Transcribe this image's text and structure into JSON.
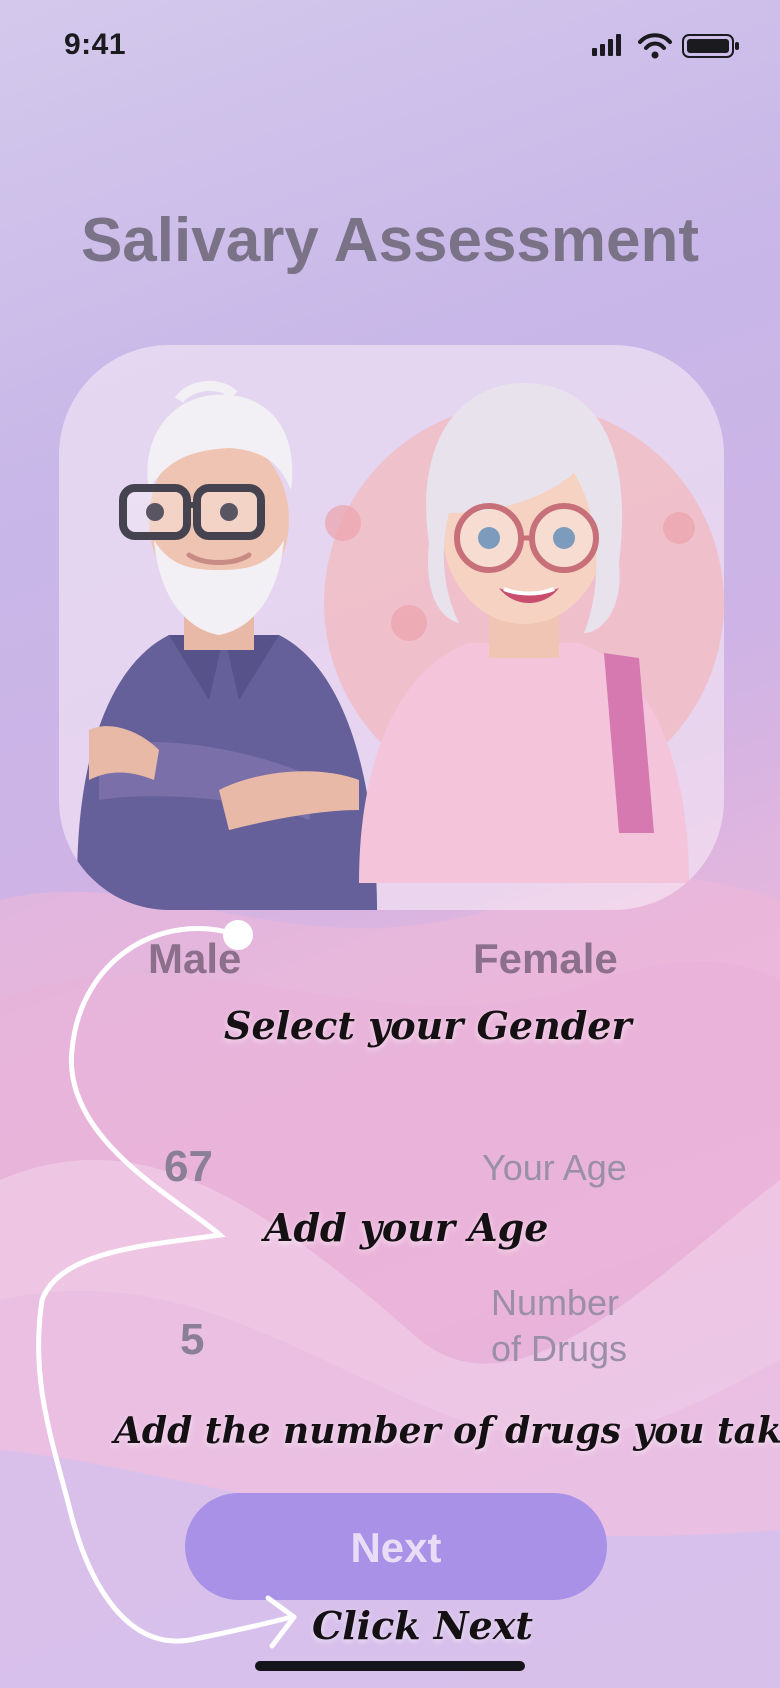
{
  "status_bar": {
    "time": "9:41",
    "icons": [
      "cellular-signal-icon",
      "wifi-icon",
      "battery-icon"
    ]
  },
  "title": "Salivary Assessment",
  "gender": {
    "male_label": "Male",
    "female_label": "Female",
    "hint": "Select your Gender"
  },
  "age": {
    "value": "67",
    "label": "Your Age",
    "hint": "Add your Age"
  },
  "drugs": {
    "value": "5",
    "label_line1": "Number",
    "label_line2": "of Drugs",
    "hint": "Add the number of drugs you take per day"
  },
  "next": {
    "label": "Next",
    "hint": "Click Next"
  },
  "colors": {
    "title": "#7a7287",
    "button": "#a891e6",
    "button_text": "#e8dcf7",
    "gender_label": "#8b6f8b",
    "hint_text": "#141014"
  }
}
